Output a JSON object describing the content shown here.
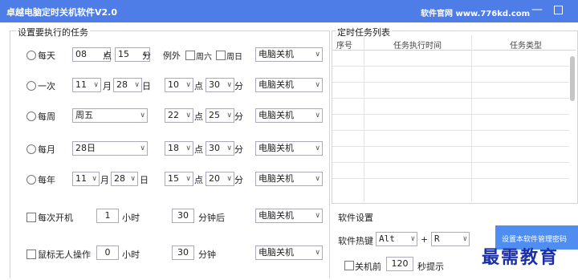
{
  "window": {
    "title": "卓越电脑定时关机软件V2.0",
    "site": "软件官网 www.776kd.com",
    "minimize": "—"
  },
  "left_group": {
    "title": "设置要执行的任务"
  },
  "units": {
    "dian": "点",
    "fen": "分",
    "yue": "月",
    "ri": "日",
    "hour": "小时",
    "min_after": "分钟后",
    "min": "分钟"
  },
  "rows": {
    "daily": {
      "label": "每天",
      "hour": "08",
      "minute": "15",
      "except": "例外",
      "sat": "周六",
      "sun": "周日",
      "action": "电脑关机"
    },
    "once": {
      "label": "一次",
      "month": "11",
      "day": "28",
      "hour": "10",
      "minute": "30",
      "action": "电脑关机"
    },
    "weekly": {
      "label": "每周",
      "weekday": "周五",
      "hour": "22",
      "minute": "25",
      "action": "电脑关机"
    },
    "monthly": {
      "label": "每月",
      "day": "28日",
      "hour": "18",
      "minute": "30",
      "action": "电脑关机"
    },
    "yearly": {
      "label": "每年",
      "month": "11",
      "day": "28",
      "hour": "15",
      "minute": "20",
      "action": "电脑关机"
    },
    "boot": {
      "label": "每次开机",
      "hours": "1",
      "minutes": "30",
      "action": "电脑关机"
    },
    "idle": {
      "label": "鼠标无人操作",
      "hours": "0",
      "minutes": "30",
      "action": "电脑关机"
    }
  },
  "task_list": {
    "title": "定时任务列表",
    "columns": [
      "序号",
      "任务执行时间",
      "任务类型"
    ]
  },
  "settings": {
    "title": "软件设置",
    "hotkey_label": "软件热键",
    "hotkey_mod": "Alt",
    "plus": "+",
    "hotkey_key": "R",
    "password_button": "设置本软件管理密码",
    "before_label": "关机前",
    "before_value": "120",
    "before_suffix": "秒提示"
  },
  "watermark": "最需教育",
  "colors": {
    "titlebar": "#4f7de8",
    "button": "#4f8ef0",
    "watermark": "#1a2ea8"
  }
}
